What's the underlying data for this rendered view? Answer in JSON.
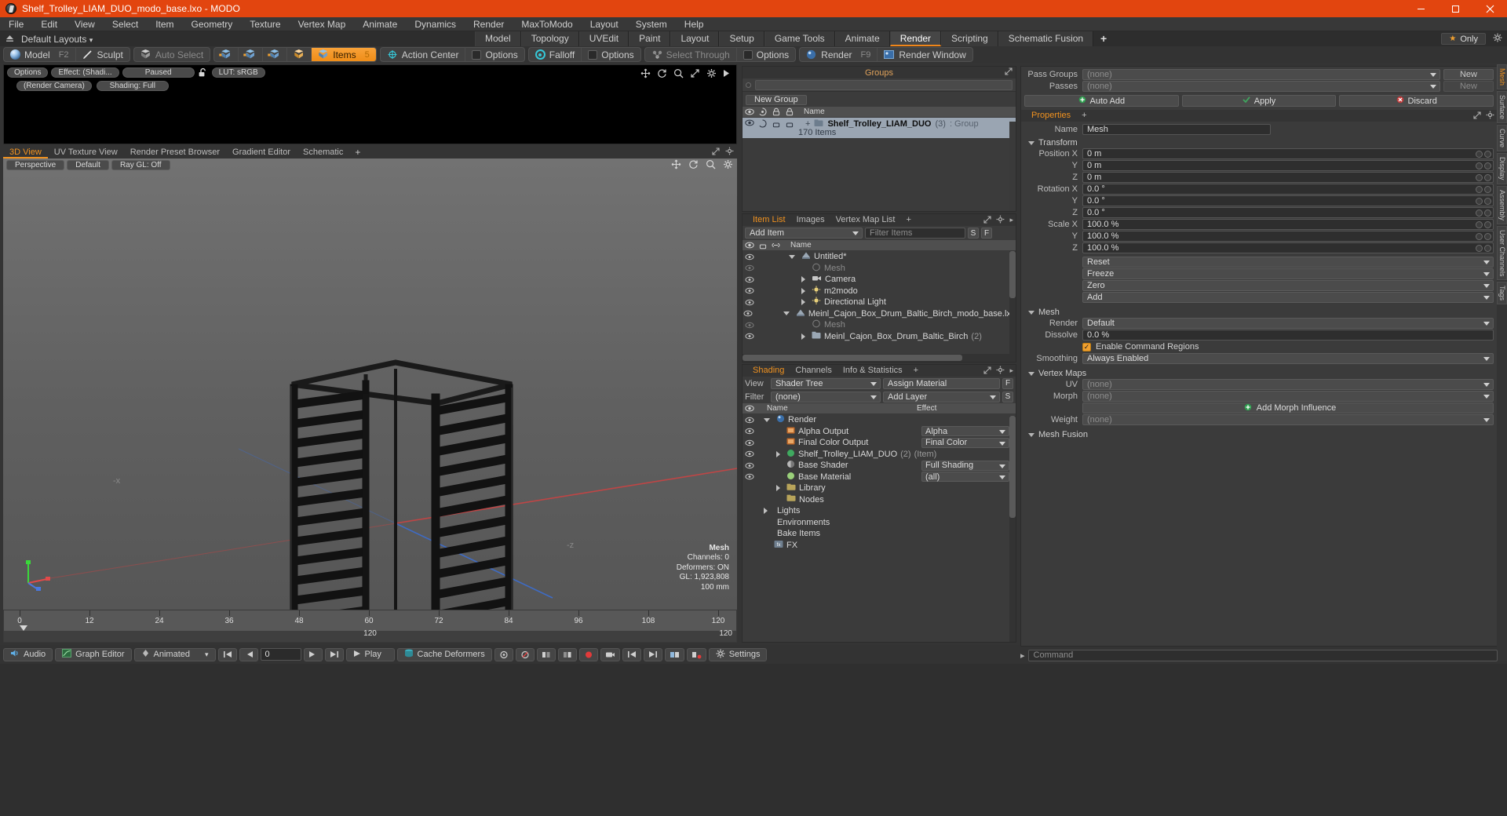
{
  "titlebar": {
    "title": "Shelf_Trolley_LIAM_DUO_modo_base.lxo - MODO",
    "logo_icon": "modo-logo-icon",
    "minimize_icon": "minimize-icon",
    "maximize_icon": "maximize-icon",
    "close_icon": "close-icon",
    "accent_color": "#e2450f"
  },
  "menubar": {
    "items": [
      "File",
      "Edit",
      "View",
      "Select",
      "Item",
      "Geometry",
      "Texture",
      "Vertex Map",
      "Animate",
      "Dynamics",
      "Render",
      "MaxToModo",
      "Layout",
      "System",
      "Help"
    ]
  },
  "layoutbar": {
    "dropdown_label": "Default Layouts",
    "tabs": [
      {
        "label": "Model",
        "active": false
      },
      {
        "label": "Topology",
        "active": false
      },
      {
        "label": "UVEdit",
        "active": false
      },
      {
        "label": "Paint",
        "active": false
      },
      {
        "label": "Layout",
        "active": false
      },
      {
        "label": "Setup",
        "active": false
      },
      {
        "label": "Game Tools",
        "active": false
      },
      {
        "label": "Animate",
        "active": false
      },
      {
        "label": "Render",
        "active": true
      },
      {
        "label": "Scripting",
        "active": false
      },
      {
        "label": "Schematic Fusion",
        "active": false
      }
    ],
    "add_label": "+",
    "only_label": "Only",
    "star_icon": "star-icon",
    "gear_icon": "gear-icon"
  },
  "modebar": {
    "groups": [
      {
        "buttons": [
          {
            "label": "Model",
            "key": "F2",
            "icon": "sphere-icon",
            "state": "normal"
          },
          {
            "label": "Sculpt",
            "key": "",
            "icon": "sculpt-pen-icon",
            "state": "normal"
          }
        ]
      },
      {
        "buttons": [
          {
            "label": "Auto Select",
            "key": "",
            "icon": "cube-grey-icon",
            "state": "dim"
          }
        ]
      },
      {
        "buttons": [
          {
            "label": "",
            "key": "",
            "icon": "vertices-cube-icon",
            "state": "normal"
          },
          {
            "label": "",
            "key": "",
            "icon": "edges-cube-icon",
            "state": "normal"
          },
          {
            "label": "",
            "key": "",
            "icon": "polygons-cube-icon",
            "state": "normal"
          },
          {
            "label": "",
            "key": "",
            "icon": "materials-cube-icon",
            "state": "normal"
          },
          {
            "label": "Items",
            "key": "5",
            "icon": "items-cube-icon",
            "state": "active"
          }
        ]
      },
      {
        "buttons": [
          {
            "label": "Action Center",
            "key": "",
            "icon": "action-center-icon",
            "state": "normal"
          },
          {
            "label": "Options",
            "key": "",
            "icon": "options-square-icon",
            "state": "normal"
          }
        ]
      },
      {
        "buttons": [
          {
            "label": "Falloff",
            "key": "",
            "icon": "falloff-icon",
            "state": "normal"
          },
          {
            "label": "Options",
            "key": "",
            "icon": "options-square-icon",
            "state": "normal"
          }
        ]
      },
      {
        "buttons": [
          {
            "label": "Select Through",
            "key": "",
            "icon": "select-through-icon",
            "state": "dim"
          },
          {
            "label": "Options",
            "key": "",
            "icon": "options-square-icon",
            "state": "normal"
          }
        ]
      },
      {
        "buttons": [
          {
            "label": "Render",
            "key": "F9",
            "icon": "render-ball-icon",
            "state": "normal"
          },
          {
            "label": "Render Window",
            "key": "",
            "icon": "render-window-icon",
            "state": "normal"
          }
        ]
      }
    ]
  },
  "render_preview": {
    "options_label": "Options",
    "effect_label": "Effect: (Shadi...",
    "status_label": "Paused",
    "lock_icon": "unlock-icon",
    "lut_label": "LUT: sRGB",
    "camera_label": "(Render Camera)",
    "shading_label": "Shading: Full",
    "play_icon": "play-triangle-icon",
    "tool_icons": [
      "move-icon",
      "rotate-icon",
      "zoom-icon",
      "fit-icon",
      "gear-icon",
      "play-small-icon"
    ]
  },
  "viewport_tabs": {
    "tabs": [
      {
        "label": "3D View",
        "active": true
      },
      {
        "label": "UV Texture View",
        "active": false
      },
      {
        "label": "Render Preset Browser",
        "active": false
      },
      {
        "label": "Gradient Editor",
        "active": false
      },
      {
        "label": "Schematic",
        "active": false
      }
    ],
    "add_label": "+",
    "maximize_icon": "maximize-panel-icon",
    "gear_icon": "gear-icon"
  },
  "viewport": {
    "view_label": "Perspective",
    "shading_label": "Default",
    "raygl_label": "Ray GL: Off",
    "tool_icons": [
      "move-icon",
      "rotate-icon",
      "zoom-icon",
      "gear-icon"
    ],
    "axis_label_z": "-z",
    "axis_label_x": "-x",
    "stats": {
      "title": "Mesh",
      "channels": "Channels: 0",
      "deformers": "Deformers: ON",
      "gl": "GL: 1,923,808",
      "scale": "100 mm"
    }
  },
  "timeline": {
    "ticks": [
      "0",
      "12",
      "24",
      "36",
      "48",
      "60",
      "72",
      "84",
      "96",
      "108",
      "120"
    ],
    "center_label": "120",
    "right_label": "120"
  },
  "bottombar": {
    "buttons": [
      {
        "label": "Audio",
        "icon": "audio-icon"
      },
      {
        "label": "Graph Editor",
        "icon": "graph-editor-icon"
      },
      {
        "label": "Animated",
        "icon": "animated-icon"
      },
      {
        "label": "Play",
        "icon": "play-icon"
      },
      {
        "label": "Cache Deformers",
        "icon": "cache-icon"
      },
      {
        "label": "Settings",
        "icon": "gear-icon"
      }
    ],
    "frame_value": "0",
    "transport_icons": [
      "skip-start-icon",
      "step-back-icon",
      "step-forward-icon",
      "skip-end-icon"
    ],
    "extra_icons": [
      "key-icon",
      "no-key-icon",
      "layers-icon",
      "ghost-icon",
      "record-icon",
      "camera-icon",
      "first-icon",
      "last-icon",
      "link-icon",
      "unlink-icon"
    ]
  },
  "groups_panel": {
    "title": "Groups",
    "maximize_icon": "maximize-panel-icon",
    "new_group_label": "New Group",
    "columns": [
      "",
      "",
      "",
      "",
      "Name"
    ],
    "column_icons": [
      "eye-icon",
      "render-icon",
      "lock-icon",
      "shade-icon"
    ],
    "rows": [
      {
        "name": "Shelf_Trolley_LIAM_DUO",
        "count": "(3)",
        "suffix": ": Group",
        "sub": "170 Items",
        "selected": true
      }
    ]
  },
  "itemlist_panel": {
    "tabs": [
      {
        "label": "Item List",
        "active": true
      },
      {
        "label": "Images",
        "active": false
      },
      {
        "label": "Vertex Map List",
        "active": false
      }
    ],
    "add_label": "+",
    "add_item_label": "Add Item",
    "filter_placeholder": "Filter Items",
    "filter_s": "S",
    "filter_f": "F",
    "column_name": "Name",
    "rows": [
      {
        "indent": 0,
        "label": "Untitled*",
        "icon": "scene-icon",
        "dim": false,
        "expander": "down"
      },
      {
        "indent": 1,
        "label": "Mesh",
        "icon": "mesh-icon",
        "dim": true,
        "expander": "none"
      },
      {
        "indent": 1,
        "label": "Camera",
        "icon": "camera-icon",
        "dim": false,
        "expander": "right"
      },
      {
        "indent": 1,
        "label": "m2modo",
        "icon": "light-icon",
        "dim": false,
        "expander": "right"
      },
      {
        "indent": 1,
        "label": "Directional Light",
        "icon": "light-icon",
        "dim": false,
        "expander": "right"
      },
      {
        "indent": 0,
        "label": "Meinl_Cajon_Box_Drum_Baltic_Birch_modo_base.lxo",
        "icon": "scene-icon",
        "dim": false,
        "expander": "down"
      },
      {
        "indent": 1,
        "label": "Mesh",
        "icon": "mesh-icon",
        "dim": true,
        "expander": "none"
      },
      {
        "indent": 1,
        "label": "Meinl_Cajon_Box_Drum_Baltic_Birch",
        "count": "(2)",
        "icon": "group-icon",
        "dim": false,
        "expander": "right"
      }
    ]
  },
  "shading_panel": {
    "tabs": [
      {
        "label": "Shading",
        "active": true
      },
      {
        "label": "Channels",
        "active": false
      },
      {
        "label": "Info & Statistics",
        "active": false
      }
    ],
    "add_label": "+",
    "view_label": "View",
    "view_value": "Shader Tree",
    "assign_material_label": "Assign Material",
    "assign_f": "F",
    "filter_label": "Filter",
    "filter_value": "(none)",
    "add_layer_label": "Add Layer",
    "add_layer_s": "S",
    "col_name": "Name",
    "col_effect": "Effect",
    "rows": [
      {
        "indent": 0,
        "label": "Render",
        "effect": "",
        "icon": "render-ball-icon",
        "expander": "down",
        "eye": true
      },
      {
        "indent": 1,
        "label": "Alpha Output",
        "effect": "Alpha",
        "icon": "output-icon",
        "expander": "none",
        "eye": true
      },
      {
        "indent": 1,
        "label": "Final Color Output",
        "effect": "Final Color",
        "icon": "output-icon",
        "expander": "none",
        "eye": true
      },
      {
        "indent": 1,
        "label": "Shelf_Trolley_LIAM_DUO",
        "count": "(2)",
        "suffix": "(Item)",
        "effect": "",
        "icon": "item-icon",
        "expander": "right",
        "eye": true
      },
      {
        "indent": 1,
        "label": "Base Shader",
        "effect": "Full Shading",
        "icon": "shader-icon",
        "expander": "none",
        "eye": true
      },
      {
        "indent": 1,
        "label": "Base Material",
        "effect": "(all)",
        "icon": "material-icon",
        "expander": "none",
        "eye": true
      },
      {
        "indent": 1,
        "label": "Library",
        "effect": "",
        "icon": "folder-icon",
        "expander": "right",
        "eye": false
      },
      {
        "indent": 1,
        "label": "Nodes",
        "effect": "",
        "icon": "folder-icon",
        "expander": "none",
        "eye": false
      },
      {
        "indent": 0,
        "label": "Lights",
        "effect": "",
        "icon": "",
        "expander": "right",
        "eye": false
      },
      {
        "indent": 0,
        "label": "Environments",
        "effect": "",
        "icon": "",
        "expander": "none",
        "eye": false
      },
      {
        "indent": 0,
        "label": "Bake Items",
        "effect": "",
        "icon": "",
        "expander": "none",
        "eye": false
      },
      {
        "indent": 0,
        "label": "FX",
        "effect": "",
        "icon": "fx-icon",
        "expander": "none",
        "eye": false
      }
    ]
  },
  "properties_panel": {
    "pass_groups_label": "Pass Groups",
    "pass_groups_value": "(none)",
    "new_label": "New",
    "passes_label": "Passes",
    "passes_value": "(none)",
    "passes_new_label": "New",
    "auto_add_label": "Auto Add",
    "apply_label": "Apply",
    "discard_label": "Discard",
    "tab_label": "Properties",
    "add_label": "+",
    "name_label": "Name",
    "name_value": "Mesh",
    "transform_label": "Transform",
    "transform_fields": [
      {
        "label": "Position X",
        "value": "0 m"
      },
      {
        "label": "Y",
        "value": "0 m"
      },
      {
        "label": "Z",
        "value": "0 m"
      },
      {
        "label": "Rotation X",
        "value": "0.0 °"
      },
      {
        "label": "Y",
        "value": "0.0 °"
      },
      {
        "label": "Z",
        "value": "0.0 °"
      },
      {
        "label": "Scale X",
        "value": "100.0 %"
      },
      {
        "label": "Y",
        "value": "100.0 %"
      },
      {
        "label": "Z",
        "value": "100.0 %"
      }
    ],
    "transform_buttons": [
      "Reset",
      "Freeze",
      "Zero",
      "Add"
    ],
    "mesh_label": "Mesh",
    "mesh_fields": [
      {
        "label": "Render",
        "value": "Default",
        "type": "select"
      },
      {
        "label": "Dissolve",
        "value": "0.0 %",
        "type": "input"
      }
    ],
    "enable_command_regions": "Enable Command Regions",
    "smoothing_label": "Smoothing",
    "smoothing_value": "Always Enabled",
    "vertex_maps_label": "Vertex Maps",
    "vertex_map_fields": [
      {
        "label": "UV",
        "value": "(none)"
      },
      {
        "label": "Morph",
        "value": "(none)"
      }
    ],
    "add_morph_label": "Add Morph Influence",
    "weight_label": "Weight",
    "weight_value": "(none)",
    "mesh_fusion_label": "Mesh Fusion"
  },
  "vertical_tabs": {
    "items": [
      "Mesh",
      "Surface",
      "Curve",
      "Display",
      "Assembly",
      "User Channels",
      "Tags"
    ]
  },
  "command_bar": {
    "placeholder": "Command",
    "arrow_icon": "chevron-right-icon"
  }
}
